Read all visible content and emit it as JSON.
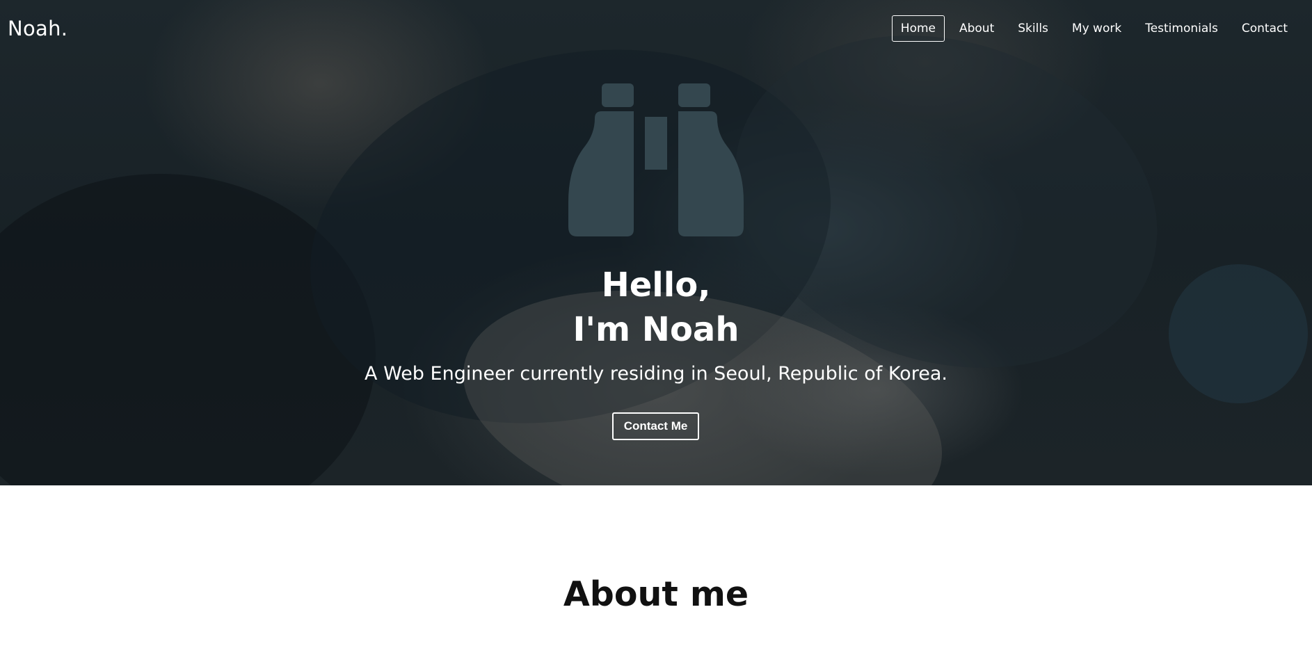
{
  "brand": "Noah.",
  "nav": {
    "items": [
      {
        "label": "Home",
        "active": true
      },
      {
        "label": "About"
      },
      {
        "label": "Skills"
      },
      {
        "label": "My work"
      },
      {
        "label": "Testimonials"
      },
      {
        "label": "Contact"
      }
    ]
  },
  "hero": {
    "icon": "binoculars-icon",
    "title_line1": "Hello,",
    "title_line2": "I'm Noah",
    "subtitle": "A Web Engineer currently residing in Seoul, Republic of Korea.",
    "cta_label": "Contact Me"
  },
  "about": {
    "title": "About me"
  },
  "colors": {
    "hero_overlay": "#1a2328",
    "icon": "#34474f",
    "text_light": "#ffffff",
    "text_dark": "#111111",
    "background": "#ffffff"
  }
}
